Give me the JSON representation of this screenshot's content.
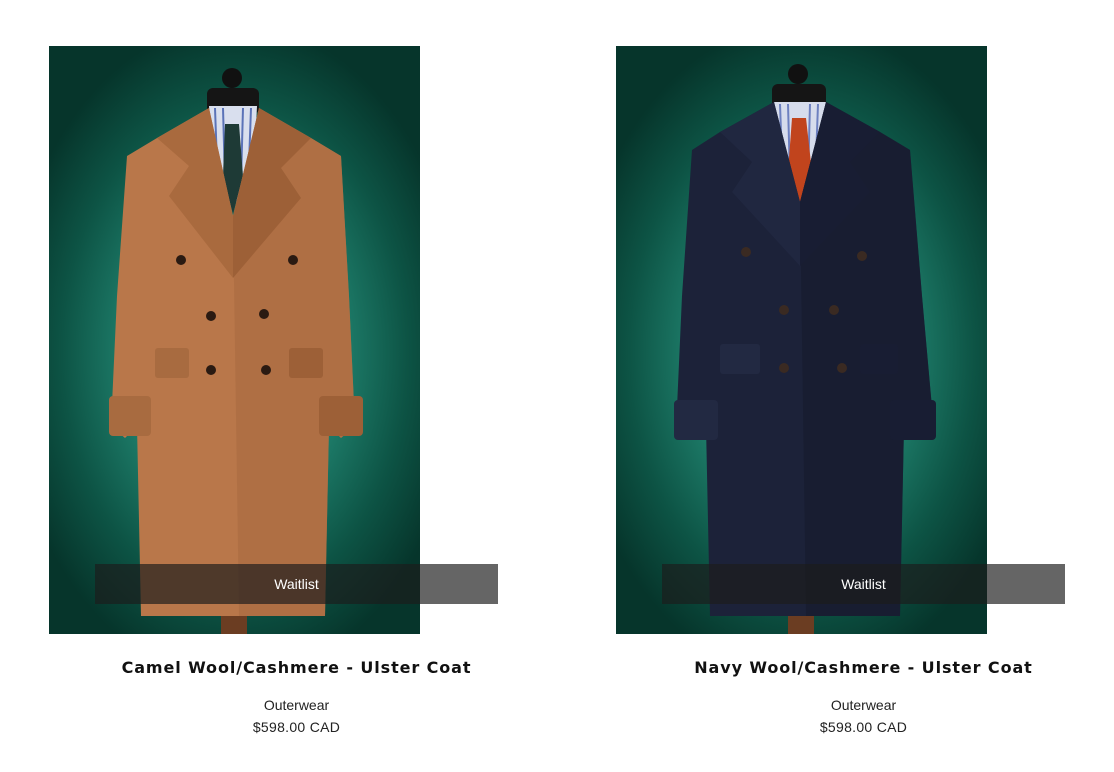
{
  "products": [
    {
      "title": "Camel Wool/Cashmere - Ulster Coat",
      "category": "Outerwear",
      "price": "$598.00 CAD",
      "action_label": "Waitlist",
      "coat_color": "#b9774a",
      "tie_color": "#1e3a36"
    },
    {
      "title": "Navy Wool/Cashmere - Ulster Coat",
      "category": "Outerwear",
      "price": "$598.00 CAD",
      "action_label": "Waitlist",
      "coat_color": "#1c2239",
      "tie_color": "#c1441d"
    }
  ],
  "colors": {
    "backdrop": "#1f7f6c",
    "waitlist_bar": "#1c1c1c"
  }
}
